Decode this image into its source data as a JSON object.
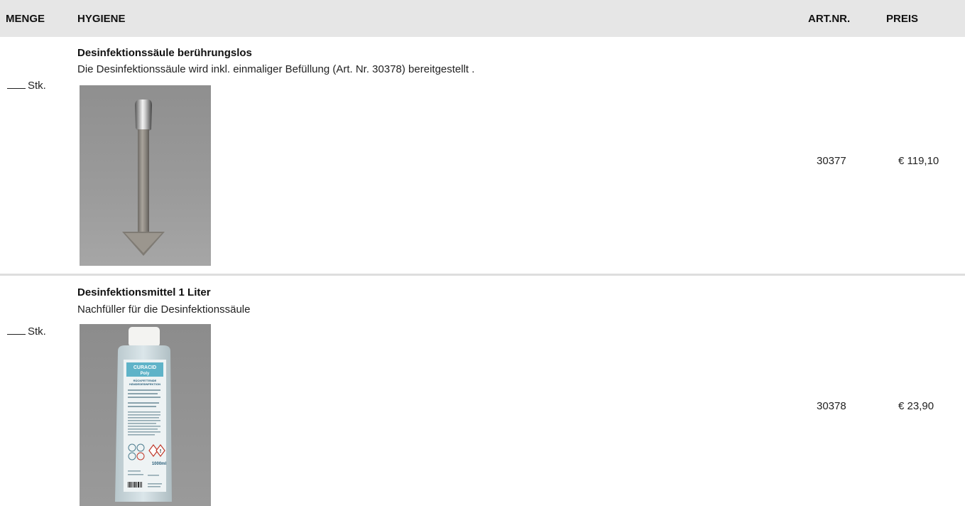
{
  "header": {
    "menge": "MENGE",
    "category": "HYGIENE",
    "art_nr": "ART.NR.",
    "preis": "PREIS"
  },
  "items": [
    {
      "qty_suffix": "Stk.",
      "title": "Desinfektionssäule berührungslos",
      "description": "Die Desinfektionssäule wird inkl. einmaliger Befüllung  (Art. Nr. 30378) bereitgestellt .",
      "art_nr": "30377",
      "price": "€ 119,10",
      "image": "disinfection-stand"
    },
    {
      "qty_suffix": "Stk.",
      "title": "Desinfektionsmittel 1 Liter",
      "description": "Nachfüller für die Desinfektionssäule",
      "art_nr": "30378",
      "price": "€ 23,90",
      "image": "disinfectant-bottle",
      "label": {
        "brand": "CURACID",
        "product": "Poly",
        "subtitle_line1": "RÜCKFETTENDE",
        "subtitle_line2": "HÄNDEDESINFEKTION",
        "volume": "1000ml"
      }
    }
  ],
  "colors": {
    "header_bg": "#e6e6e6",
    "separator": "#dedede"
  }
}
